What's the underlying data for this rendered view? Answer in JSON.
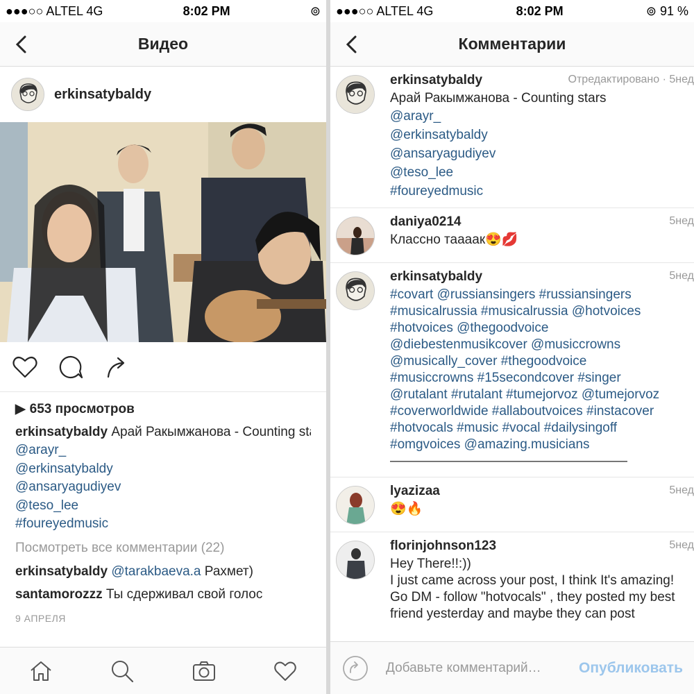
{
  "left": {
    "status": {
      "carrier": "●●●○○ ALTEL 4G",
      "time": "8:02 PM"
    },
    "nav_title": "Видео",
    "post": {
      "username": "erkinsatybaldy",
      "views": "653 просмотров",
      "caption_user": "erkinsatybaldy",
      "caption_text": "Арай Ракымжанова - Counting stars",
      "mentions": [
        "@arayr_",
        "@erkinsatybaldy",
        "@ansaryagudiyev",
        "@teso_lee",
        "#foureyedmusic"
      ],
      "view_all": "Посмотреть все комментарии (22)",
      "comments": [
        {
          "user": "erkinsatybaldy",
          "mention": "@tarakbaeva.a",
          "text": " Рахмет)"
        },
        {
          "user": "santamorozzz",
          "mention": "",
          "text": " Ты сдерживал свой голос"
        }
      ],
      "date": "9 АПРЕЛЯ"
    },
    "icons": [
      "heart-icon",
      "comment-icon",
      "share-icon",
      "home-icon",
      "search-icon",
      "camera-icon",
      "activity-heart-icon"
    ]
  },
  "right": {
    "status": {
      "carrier": "●●●○○ ALTEL 4G",
      "time": "8:02 PM",
      "battery": "91 %"
    },
    "nav_title": "Комментарии",
    "comments": [
      {
        "user": "erkinsatybaldy",
        "meta": "Отредактировано · 5нед",
        "lines": [
          "Арай Ракымжанова - Counting stars"
        ],
        "blue_lines": [
          "@arayr_",
          "@erkinsatybaldy",
          "@ansaryagudiyev",
          "@teso_lee",
          "#foureyedmusic"
        ]
      },
      {
        "user": "daniya0214",
        "meta": "5нед",
        "lines": [
          "Классно тааaак😍💋"
        ],
        "blue_lines": []
      },
      {
        "user": "erkinsatybaldy",
        "meta": "5нед",
        "lines": [],
        "blue_lines": [
          "#covart @russiansingers #russiansingers",
          "#musicalrussia #musicalrussia @hotvoices",
          "#hotvoices @thegoodvoice",
          "@diebestenmusikcover @musiccrowns",
          "@musically_cover #thegoodvoice",
          "#musiccrowns #15secondcover #singer",
          "@rutalant #rutalant #tumejorvoz @tumejorvoz",
          "#coverworldwide #allaboutvoices #instacover",
          "#hotvocals #music #vocal #dailysingoff",
          "#omgvoices @amazing.musicians"
        ],
        "tail": "——————————————————"
      },
      {
        "user": "lyazizaa",
        "meta": "5нед",
        "lines": [
          "😍🔥"
        ],
        "blue_lines": []
      },
      {
        "user": "florinjohnson123",
        "meta": "5нед",
        "lines": [
          "Hey There!!:))",
          "I just came across your post, I think It's amazing!",
          "Go DM - follow \"hotvocals\" , they posted my best friend yesterday and maybe they can post"
        ],
        "blue_lines": []
      }
    ],
    "input_placeholder": "Добавьте комментарий…",
    "publish_label": "Опубликовать"
  }
}
